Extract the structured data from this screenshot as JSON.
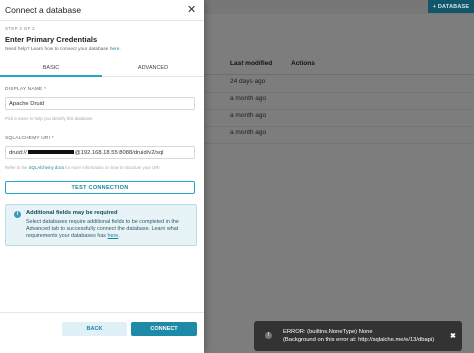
{
  "background": {
    "add_database_label": "+ DATABASE",
    "columns": {
      "last_modified": "Last modified",
      "actions": "Actions"
    },
    "rows": [
      {
        "last_modified": "24 days ago"
      },
      {
        "last_modified": "a month ago"
      },
      {
        "last_modified": "a month ago"
      },
      {
        "last_modified": "a month ago"
      }
    ]
  },
  "modal": {
    "title": "Connect a database",
    "step": "STEP 2 OF 2",
    "heading": "Enter Primary Credentials",
    "help_prefix": "Need help? Learn how to connect your database",
    "help_link": "here",
    "help_suffix": ".",
    "tabs": {
      "basic": "BASIC",
      "advanced": "ADVANCED"
    },
    "display_name": {
      "label": "DISPLAY NAME *",
      "value": "Apache Druid",
      "hint": "Pick a name to help you identify this database."
    },
    "sqlalchemy": {
      "label": "SQLALCHEMY URI *",
      "value_prefix": "druid://",
      "value_suffix": "@192.168.18.55:8088/druid/v2/sql",
      "hint_prefix": "Refer to the",
      "hint_link": "SQLAlchemy docs",
      "hint_suffix": "for more information on how to structure your URI."
    },
    "test_connection_label": "TEST CONNECTION",
    "alert": {
      "title": "Additional fields may be required",
      "body_prefix": "Select databases require additional fields to be completed in the Advanced tab to successfully connect the database. Learn what requirements your databases has",
      "body_link": "here",
      "body_suffix": "."
    },
    "back_label": "BACK",
    "connect_label": "CONNECT"
  },
  "toast": {
    "line1": "ERROR: (builtins.NoneType) None",
    "line2": "(Background on this error at: http://sqlalche.me/e/13/dbapi)",
    "icon": "!",
    "close": "✖"
  },
  "colors": {
    "accent": "#20a7c9",
    "primary_button": "#1d8ba8",
    "overlay": "#7d7d7d",
    "toast": "#333333"
  }
}
